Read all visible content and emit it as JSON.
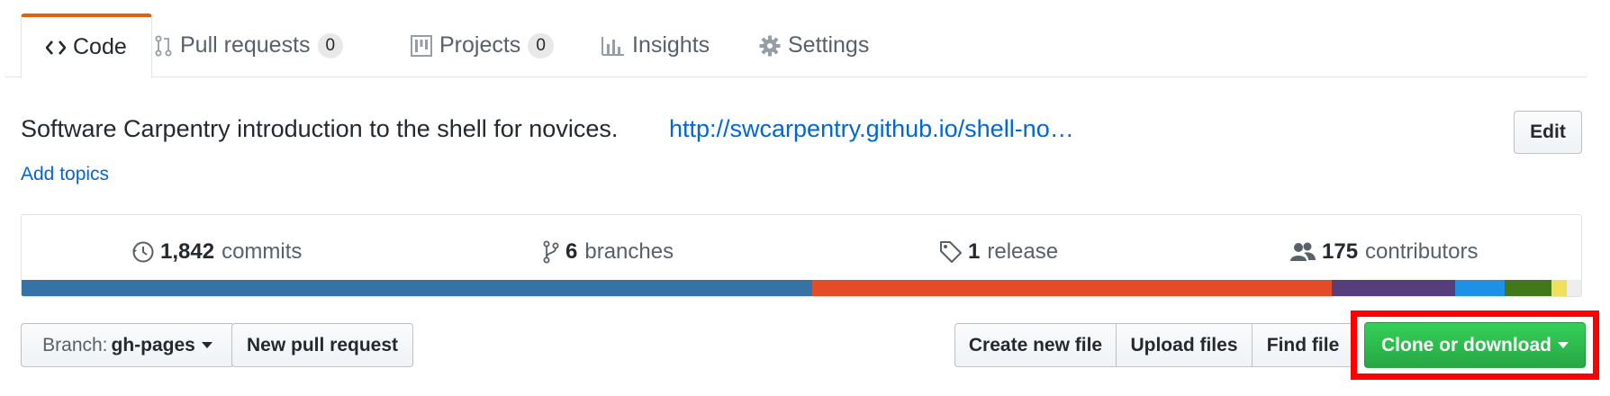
{
  "tabs": [
    {
      "label": "Code",
      "icon": "code-icon",
      "selected": true
    },
    {
      "label": "Pull requests",
      "icon": "git-pull-request-icon",
      "count": "0"
    },
    {
      "label": "Projects",
      "icon": "project-icon",
      "count": "0"
    },
    {
      "label": "Insights",
      "icon": "graph-icon"
    },
    {
      "label": "Settings",
      "icon": "gear-icon"
    }
  ],
  "repo": {
    "description": "Software Carpentry introduction to the shell for novices.",
    "homepage": "http://swcarpentry.github.io/shell-no…",
    "add_topics": "Add topics",
    "edit_label": "Edit"
  },
  "summary": {
    "commits": {
      "num": "1,842",
      "label": "commits",
      "icon": "history-icon"
    },
    "branches": {
      "num": "6",
      "label": "branches",
      "icon": "git-branch-icon"
    },
    "releases": {
      "num": "1",
      "label": "release",
      "icon": "tag-icon"
    },
    "contributors": {
      "num": "175",
      "label": "contributors",
      "icon": "organization-icon"
    }
  },
  "languages": [
    {
      "color": "#3572A5",
      "percent": 50.7
    },
    {
      "color": "#e34c26",
      "percent": 33.3
    },
    {
      "color": "#563d7c",
      "percent": 7.9
    },
    {
      "color": "#1e90e6",
      "percent": 3.2
    },
    {
      "color": "#427819",
      "percent": 3.0
    },
    {
      "color": "#f1e05a",
      "percent": 1.0
    },
    {
      "color": "#ededed",
      "percent": 0.9
    }
  ],
  "file_nav": {
    "branch_prefix": "Branch:",
    "branch_name": "gh-pages",
    "new_pull_request": "New pull request",
    "create_new_file": "Create new file",
    "upload_files": "Upload files",
    "find_file": "Find file",
    "clone_or_download": "Clone or download"
  },
  "colors": {
    "accent_tab": "#e36209",
    "link": "#0366d6",
    "clone_button": "#28a745",
    "highlight_frame": "#ff0000"
  }
}
